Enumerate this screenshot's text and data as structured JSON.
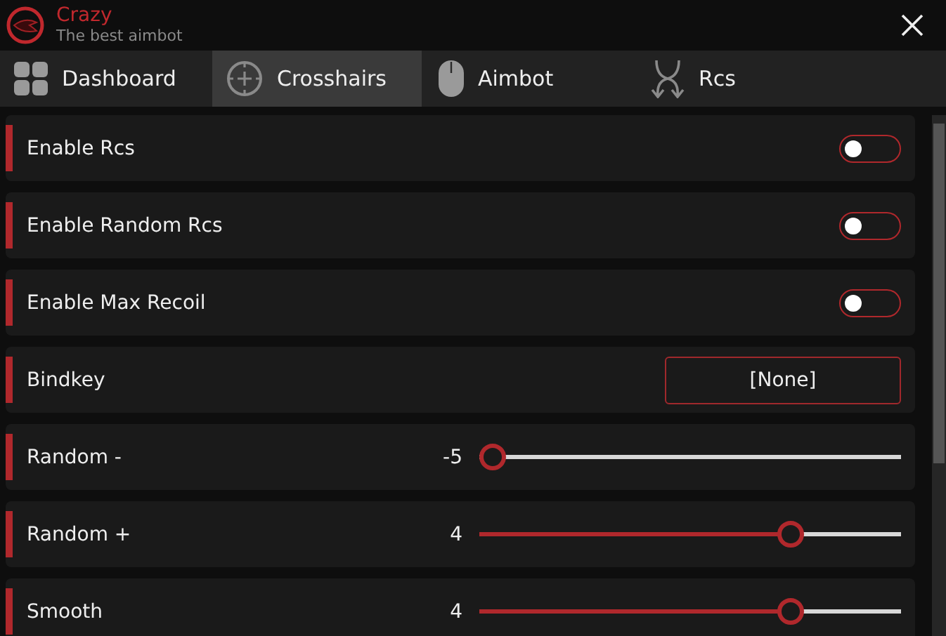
{
  "app": {
    "title": "Crazy",
    "subtitle": "The best aimbot"
  },
  "tabs": [
    {
      "label": "Dashboard",
      "selected": false
    },
    {
      "label": "Crosshairs",
      "selected": true
    },
    {
      "label": "Aimbot",
      "selected": false
    },
    {
      "label": "Rcs",
      "selected": false
    }
  ],
  "settings": [
    {
      "kind": "toggle",
      "label": "Enable Rcs",
      "on": false
    },
    {
      "kind": "toggle",
      "label": "Enable Random Rcs",
      "on": false
    },
    {
      "kind": "toggle",
      "label": "Enable Max Recoil",
      "on": false
    },
    {
      "kind": "keybind",
      "label": "Bindkey",
      "value": "[None]"
    },
    {
      "kind": "slider",
      "label": "Random -",
      "reading": "-5",
      "level": 0
    },
    {
      "kind": "slider",
      "label": "Random +",
      "reading": "4",
      "level": 0.75
    },
    {
      "kind": "slider",
      "label": "Smooth",
      "reading": "4",
      "level": 0.75
    }
  ]
}
